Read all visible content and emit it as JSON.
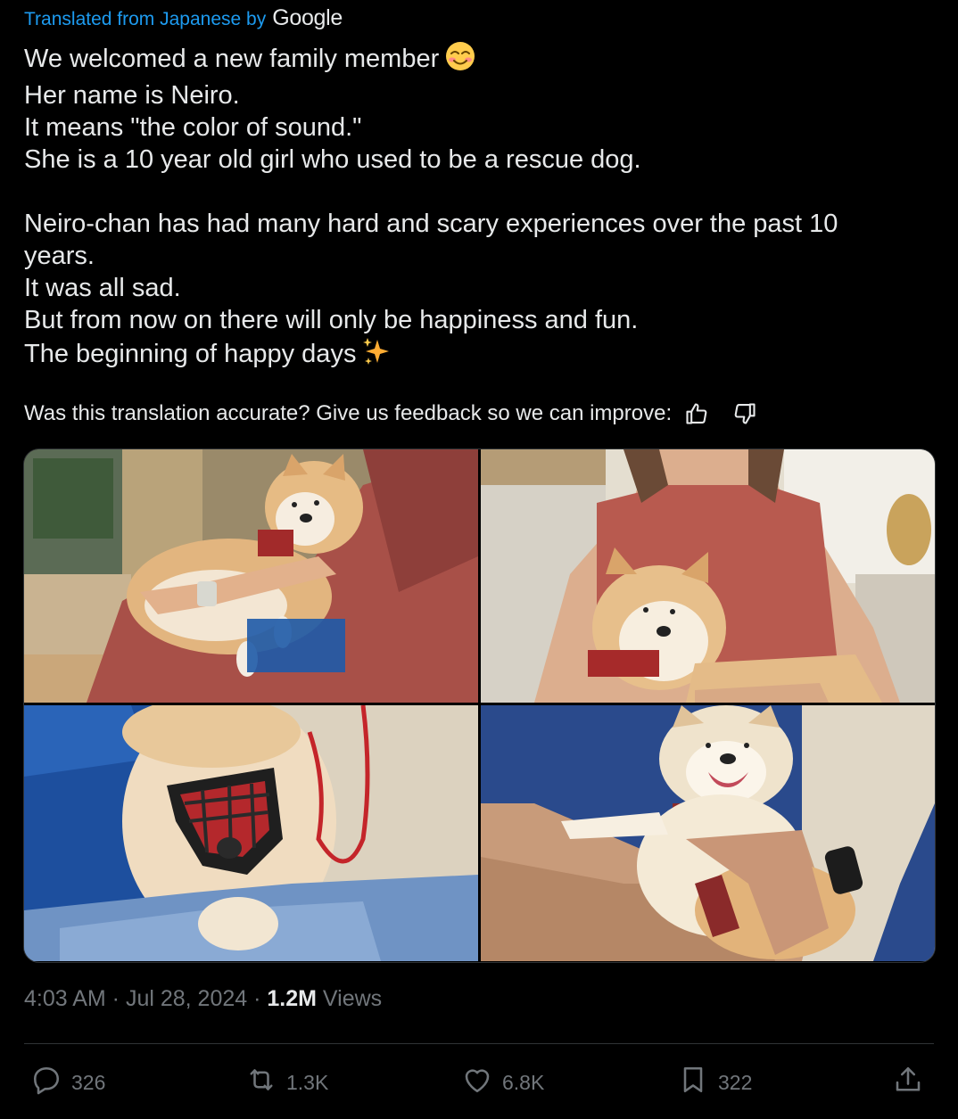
{
  "translation": {
    "prefix": "Translated from Japanese by",
    "brand": "Google"
  },
  "tweet": {
    "lines": [
      "We welcomed a new family member",
      "Her name is Neiro.",
      "It means \"the color of sound.\"",
      "She is a 10 year old girl who used to be a rescue dog.",
      "",
      "Neiro-chan has had many hard and scary experiences over the past 10",
      "years.",
      "It was all sad.",
      "But from now on there will only be happiness and fun.",
      "The beginning of happy days"
    ],
    "emoji_line1": "smiling-face-icon",
    "emoji_last": "sparkles-icon"
  },
  "feedback": {
    "prompt": "Was this translation accurate? Give us feedback so we can improve:",
    "thumbs_up_icon": "thumbs-up-icon",
    "thumbs_down_icon": "thumbs-down-icon"
  },
  "media": {
    "photos": [
      {
        "subject": "dog-on-lap-red-dress"
      },
      {
        "subject": "dog-portrait-red-top"
      },
      {
        "subject": "dog-harness-closeup"
      },
      {
        "subject": "dog-smiling-blue-shirt"
      }
    ]
  },
  "meta": {
    "time": "4:03 AM",
    "sep1": " · ",
    "date": "Jul 28, 2024",
    "sep2": " · ",
    "views_count": "1.2M",
    "views_label": " Views"
  },
  "actions": {
    "replies": "326",
    "reposts": "1.3K",
    "likes": "6.8K",
    "bookmarks": "322"
  },
  "colors": {
    "background": "#000000",
    "text": "#e7e9ea",
    "muted": "#71767b",
    "link": "#1d9bf0",
    "divider": "#2f3336"
  }
}
